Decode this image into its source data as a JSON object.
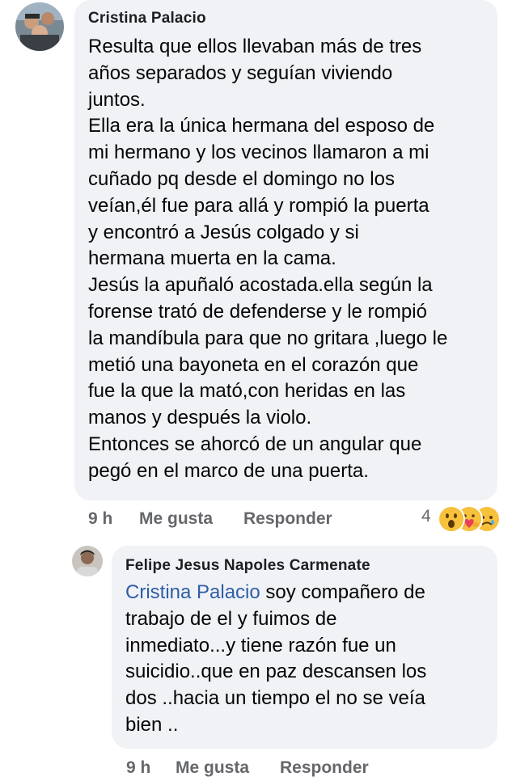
{
  "comment": {
    "author": "Cristina Palacio",
    "lines": [
      "Resulta que  ellos llevaban más  de tres",
      "años  separados y seguían viviendo",
      "juntos.",
      "Ella era la única  hermana del esposo de",
      "mi hermano y los vecinos llamaron a mi",
      "cuñado pq desde el domingo  no los",
      "veían,él  fue para allá y rompió  la puerta",
      "y encontró  a Jesús  colgado y si",
      "hermana muerta en la cama.",
      "Jesús  la apuñaló  acostada.ella según la",
      "forense trató de defenderse y le rompió",
      "la mandíbula para que no gritara ,luego le",
      "metió una bayoneta  en el corazón que",
      "fue la que la mató,con heridas en las",
      "manos y después  la violo.",
      "Entonces se ahorcó de un angular que",
      "pegó  en el marco de una puerta."
    ],
    "time": "9 h",
    "like_label": "Me gusta",
    "reply_label": "Responder",
    "reaction_count": "4",
    "reactions": [
      "wow-icon",
      "care-icon",
      "sad-icon"
    ]
  },
  "reply": {
    "author": "Felipe Jesus Napoles Carmenate",
    "mention": "Cristina Palacio",
    "first_line_rest": " soy compañero de",
    "lines": [
      "trabajo de el y fuimos de",
      "inmediato...y tiene razón fue un",
      "suicidio..que en paz descansen los",
      "dos ..hacia un tiempo el no se veía",
      "bien .."
    ],
    "time": "9 h",
    "like_label": "Me gusta",
    "reply_label": "Responder"
  }
}
